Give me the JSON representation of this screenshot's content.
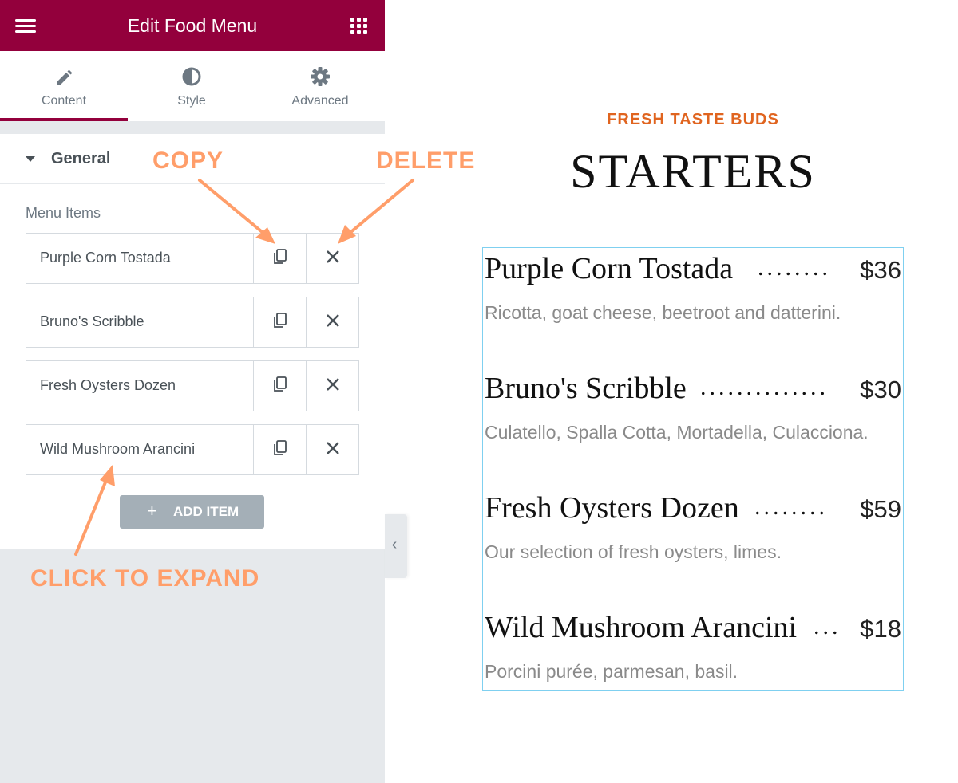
{
  "panel": {
    "header": {
      "title": "Edit Food Menu"
    },
    "tabs": [
      {
        "label": "Content",
        "icon": "pencil-icon",
        "active": true
      },
      {
        "label": "Style",
        "icon": "contrast-icon",
        "active": false
      },
      {
        "label": "Advanced",
        "icon": "gear-icon",
        "active": false
      }
    ],
    "section": {
      "title": "General",
      "field_label": "Menu Items"
    },
    "items": [
      {
        "title": "Purple Corn Tostada"
      },
      {
        "title": "Bruno's Scribble"
      },
      {
        "title": "Fresh Oysters Dozen"
      },
      {
        "title": "Wild Mushroom Arancini"
      }
    ],
    "add_item": {
      "plus": "+",
      "label": "ADD ITEM"
    }
  },
  "annotations": {
    "copy": "COPY",
    "delete": "DELETE",
    "expand": "CLICK TO EXPAND"
  },
  "preview": {
    "subtitle": "FRESH TASTE BUDS",
    "title": "STARTERS",
    "items": [
      {
        "name": "Purple Corn Tostada",
        "dots": "........",
        "price": "$36",
        "description": "Ricotta, goat cheese, beetroot and datterini."
      },
      {
        "name": "Bruno's Scribble",
        "dots": "..............",
        "price": "$30",
        "description": "Culatello, Spalla Cotta, Mortadella, Culacciona."
      },
      {
        "name": "Fresh Oysters Dozen",
        "dots": "........",
        "price": "$59",
        "description": "Our selection of fresh oysters, limes."
      },
      {
        "name": "Wild Mushroom Arancini",
        "dots": "...",
        "price": "$18",
        "description": "Porcini purée, parmesan, basil."
      }
    ]
  },
  "colors": {
    "header": "#93003c",
    "accent_annotation": "#ff9e6a",
    "subtitle": "#e0641f",
    "add_button": "#a4afb7",
    "preview_border": "#7fd0f0"
  }
}
